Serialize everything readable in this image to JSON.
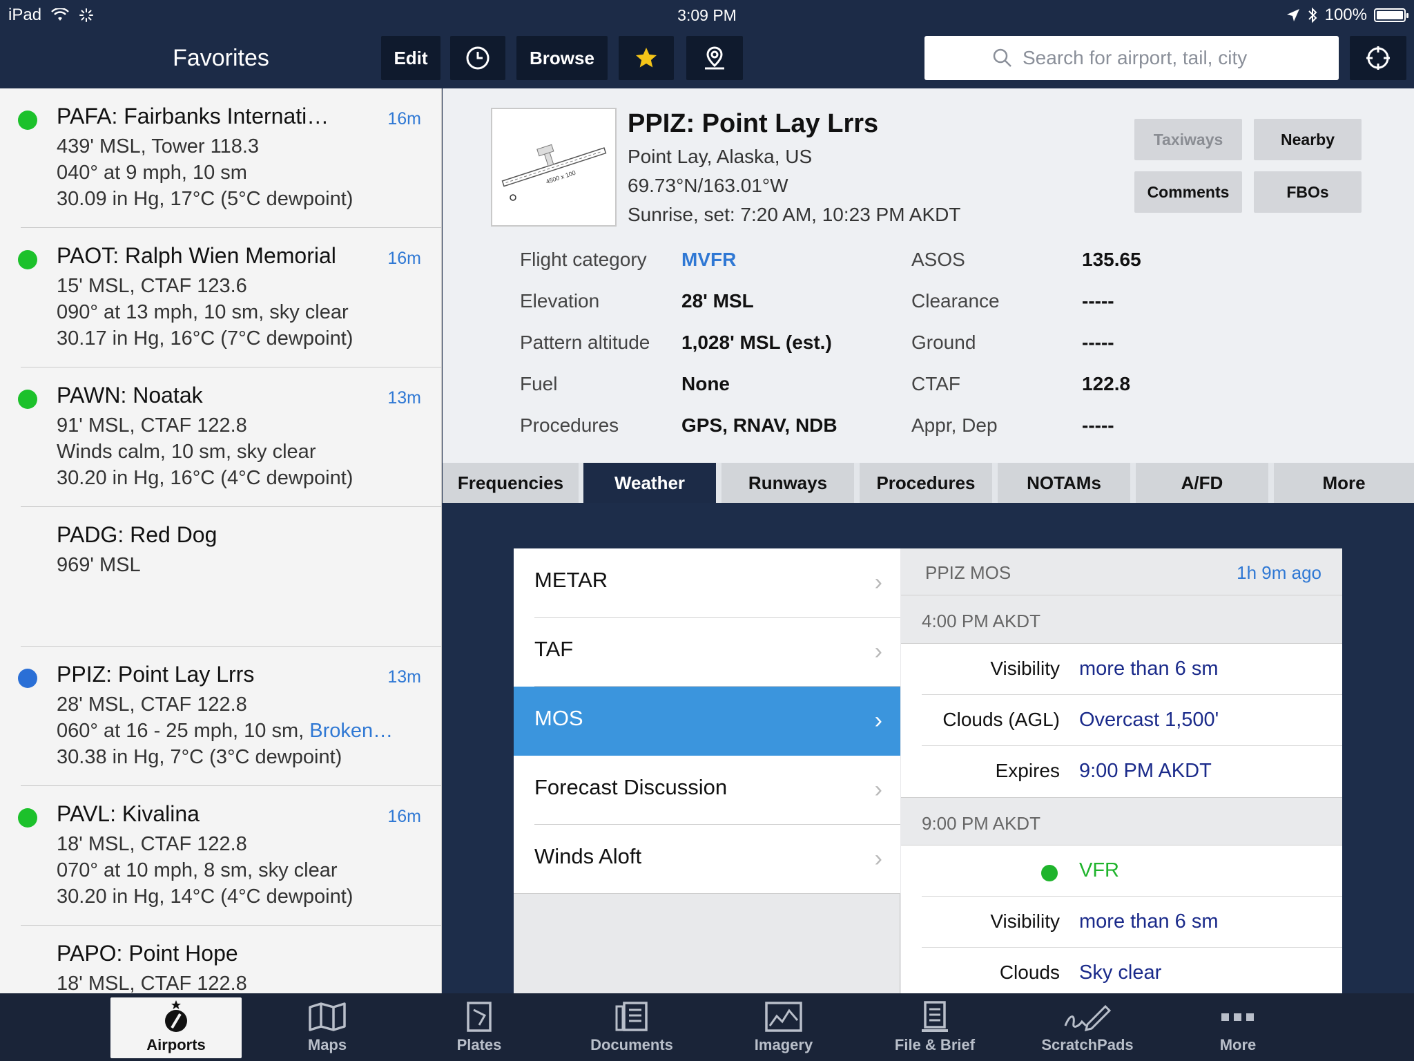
{
  "status_bar": {
    "device": "iPad",
    "time": "3:09 PM",
    "battery": "100%"
  },
  "nav": {
    "title": "Favorites",
    "edit": "Edit",
    "browse": "Browse",
    "search_placeholder": "Search for airport, tail, city"
  },
  "favorites": [
    {
      "title": "PAFA: Fairbanks Internati…",
      "age": "16m",
      "status_color": "#1cc12b",
      "line1": "439' MSL, Tower 118.3",
      "line2": "040° at 9 mph, 10 sm",
      "line3": "30.09 in Hg, 17°C (5°C dewpoint)"
    },
    {
      "title": "PAOT: Ralph Wien Memorial",
      "age": "16m",
      "status_color": "#1cc12b",
      "line1": "15' MSL, CTAF 123.6",
      "line2": "090° at 13 mph, 10 sm, sky clear",
      "line3": "30.17 in Hg, 16°C (7°C dewpoint)"
    },
    {
      "title": "PAWN: Noatak",
      "age": "13m",
      "status_color": "#1cc12b",
      "line1": "91' MSL, CTAF 122.8",
      "line2": "Winds calm, 10 sm, sky clear",
      "line3": "30.20 in Hg, 16°C (4°C dewpoint)"
    },
    {
      "title": "PADG: Red Dog",
      "line1": "969' MSL"
    },
    {
      "title": "PPIZ: Point Lay Lrrs",
      "age": "13m",
      "status_color": "#2a6fd6",
      "line1": "28' MSL, CTAF 122.8",
      "line2": "060° at 16 - 25 mph, 10 sm, ",
      "line2_link": "Broken…",
      "line3": "30.38 in Hg, 7°C (3°C dewpoint)"
    },
    {
      "title": "PAVL: Kivalina",
      "age": "16m",
      "status_color": "#1cc12b",
      "line1": "18' MSL, CTAF 122.8",
      "line2": "070° at 10 mph, 8 sm, sky clear",
      "line3": "30.20 in Hg, 14°C (4°C dewpoint)"
    },
    {
      "title": "PAPO: Point Hope",
      "line1": "18' MSL, CTAF 122.8"
    }
  ],
  "airport": {
    "title": "PPIZ: Point Lay Lrrs",
    "location": "Point Lay, Alaska, US",
    "coords": "69.73°N/163.01°W",
    "sun": "Sunrise, set: 7:20 AM, 10:23 PM AKDT",
    "buttons": {
      "taxiways": "Taxiways",
      "nearby": "Nearby",
      "comments": "Comments",
      "fbos": "FBOs"
    },
    "diagram_label": "4500 x 100",
    "left_info": [
      {
        "label": "Flight category",
        "value": "MVFR"
      },
      {
        "label": "Elevation",
        "value": "28' MSL"
      },
      {
        "label": "Pattern altitude",
        "value": "1,028' MSL (est.)"
      },
      {
        "label": "Fuel",
        "value": "None"
      },
      {
        "label": "Procedures",
        "value": "GPS, RNAV, NDB"
      }
    ],
    "right_info": [
      {
        "label": "ASOS",
        "value": "135.65"
      },
      {
        "label": "Clearance",
        "value": "-----"
      },
      {
        "label": "Ground",
        "value": "-----"
      },
      {
        "label": "CTAF",
        "value": "122.8"
      },
      {
        "label": "Appr, Dep",
        "value": "-----"
      }
    ]
  },
  "tabs": [
    "Frequencies",
    "Weather",
    "Runways",
    "Procedures",
    "NOTAMs",
    "A/FD",
    "More"
  ],
  "weather_menu": [
    "METAR",
    "TAF",
    "MOS",
    "Forecast Discussion",
    "Winds Aloft"
  ],
  "mos": {
    "header": "PPIZ MOS",
    "age": "1h 9m ago",
    "section1": "4:00 PM AKDT",
    "s1_visibility_label": "Visibility",
    "s1_visibility": "more than 6 sm",
    "s1_clouds_label": "Clouds (AGL)",
    "s1_clouds": "Overcast 1,500'",
    "s1_expires_label": "Expires",
    "s1_expires": "9:00 PM AKDT",
    "section2": "9:00 PM AKDT",
    "s2_category": "VFR",
    "s2_visibility_label": "Visibility",
    "s2_visibility": "more than 6 sm",
    "s2_clouds_label": "Clouds",
    "s2_clouds": "Sky clear"
  },
  "bottom_tabs": [
    "Airports",
    "Maps",
    "Plates",
    "Documents",
    "Imagery",
    "File & Brief",
    "ScratchPads",
    "More"
  ],
  "colors": {
    "vfr_green": "#1fb42c",
    "accent_blue": "#2f78d4",
    "nav_bg": "#1c2b47",
    "selected_row": "#3b95dd"
  }
}
